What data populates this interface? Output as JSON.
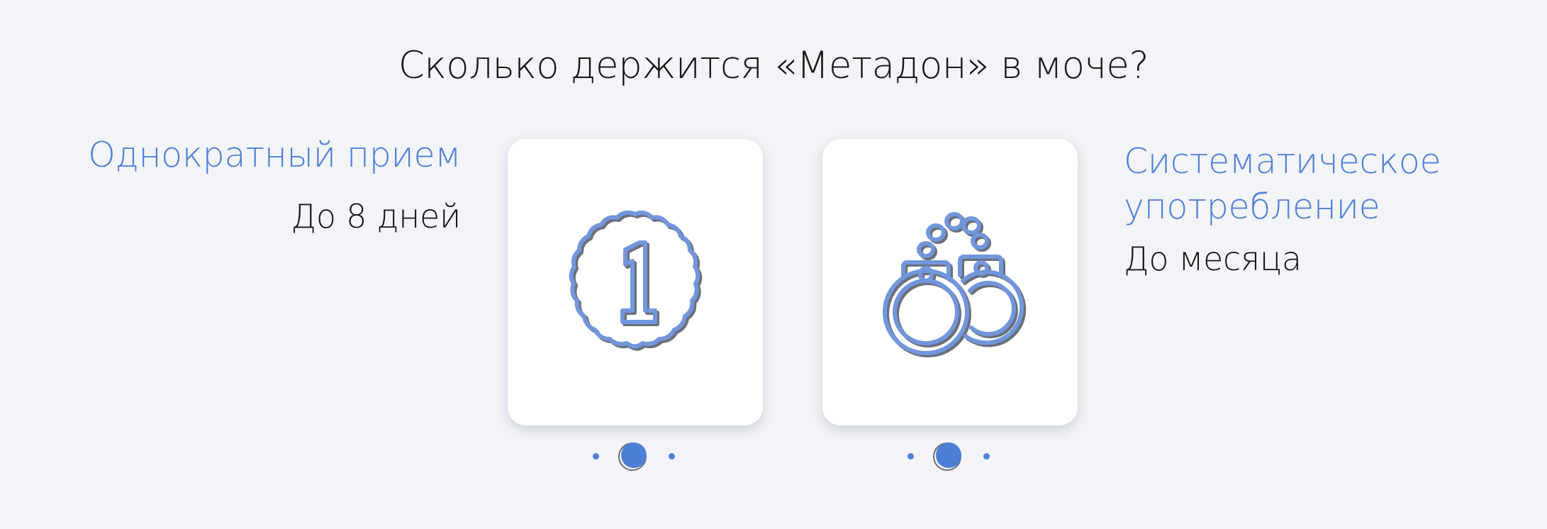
{
  "title": "Сколько держится «Метадон» в моче?",
  "single_dose": {
    "label": "Однократный прием",
    "value": "До 8 дней"
  },
  "systematic_use": {
    "label": "Систематическое употребление",
    "value": "До месяца"
  },
  "cards": [
    {
      "icon": "number-one-badge-icon"
    },
    {
      "icon": "handcuffs-icon"
    }
  ],
  "colors": {
    "background": "#f3f4f8",
    "accent": "#4f80d9",
    "text": "#161616",
    "card": "#ffffff"
  }
}
